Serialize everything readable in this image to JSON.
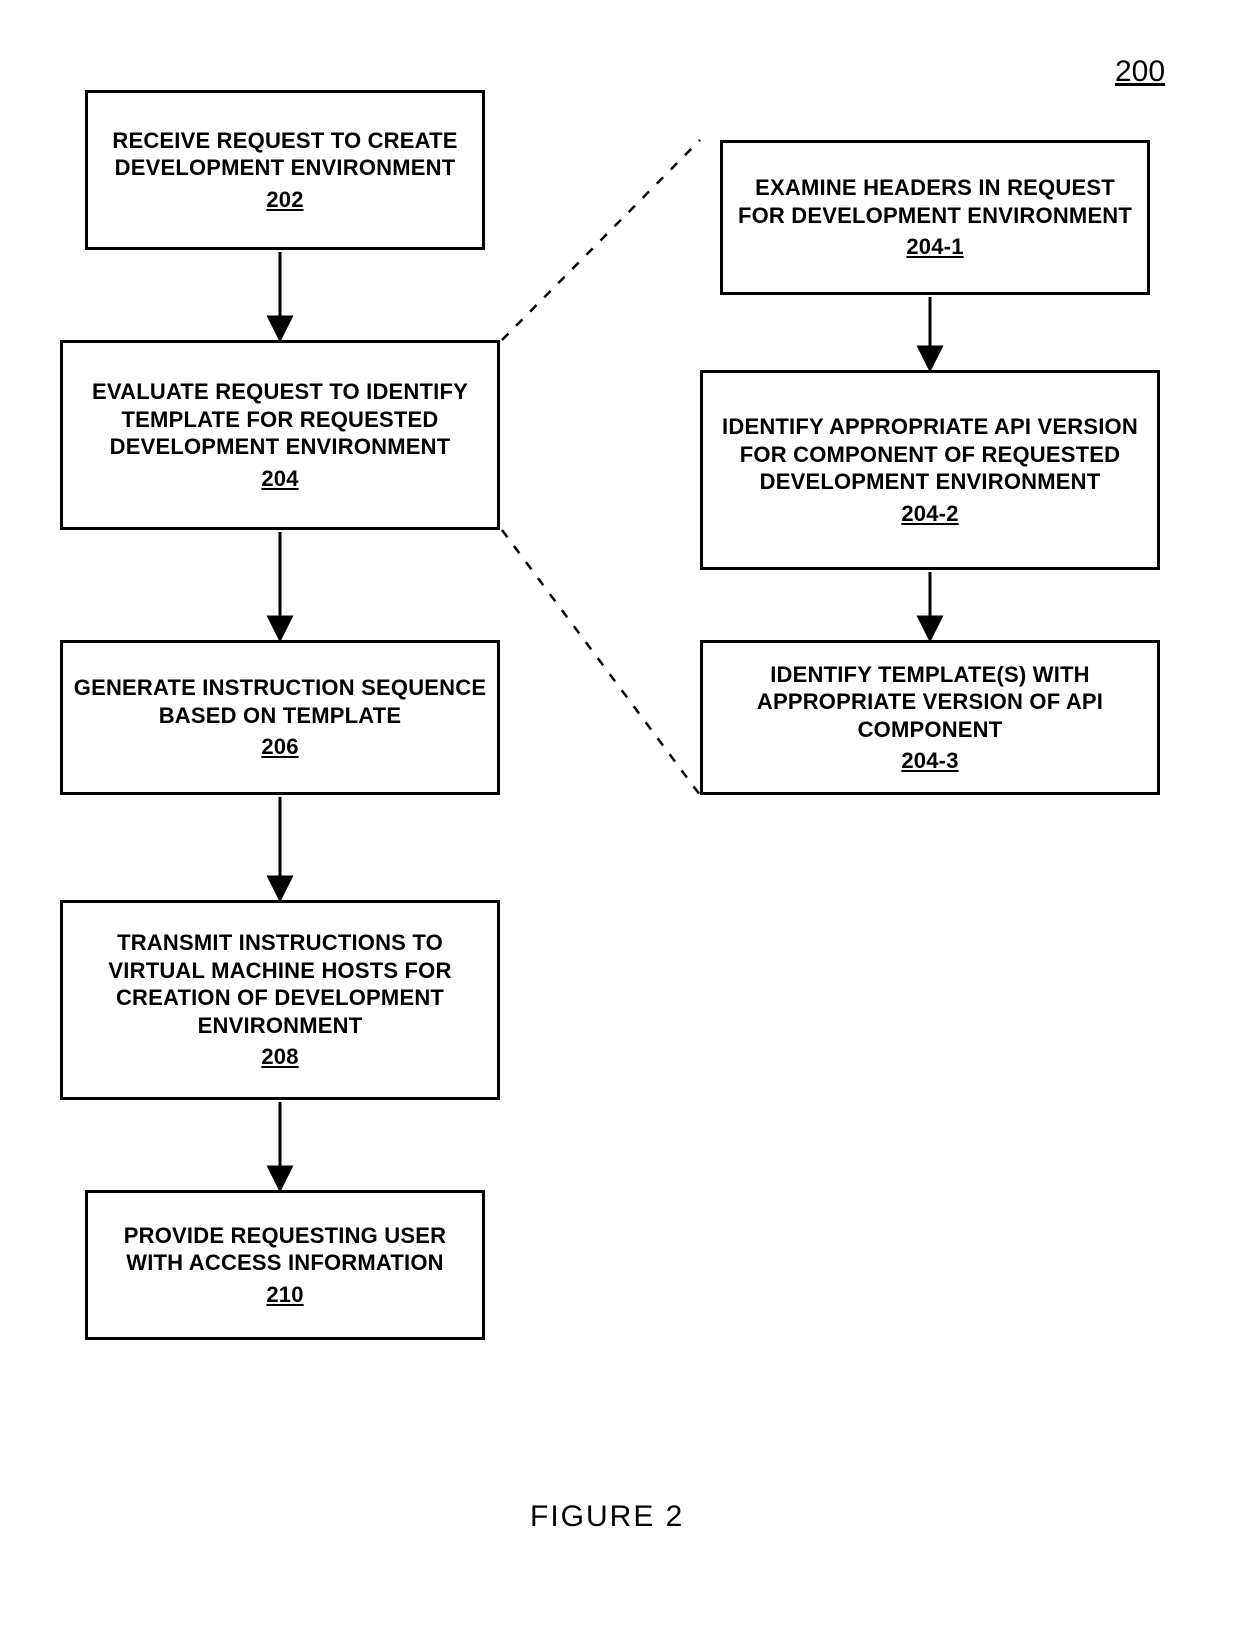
{
  "figure_ref": "200",
  "figure_label": "FIGURE 2",
  "left": {
    "b202": {
      "text": "RECEIVE REQUEST TO CREATE DEVELOPMENT ENVIRONMENT",
      "ref": "202"
    },
    "b204": {
      "text": "EVALUATE REQUEST TO IDENTIFY TEMPLATE FOR REQUESTED DEVELOPMENT ENVIRONMENT",
      "ref": "204"
    },
    "b206": {
      "text": "GENERATE INSTRUCTION SEQUENCE BASED ON TEMPLATE",
      "ref": "206"
    },
    "b208": {
      "text": "TRANSMIT INSTRUCTIONS TO VIRTUAL MACHINE HOSTS FOR CREATION OF DEVELOPMENT ENVIRONMENT",
      "ref": "208"
    },
    "b210": {
      "text": "PROVIDE REQUESTING USER WITH ACCESS INFORMATION",
      "ref": "210"
    }
  },
  "right": {
    "b204_1": {
      "text": "EXAMINE HEADERS IN REQUEST FOR DEVELOPMENT ENVIRONMENT",
      "ref": "204-1"
    },
    "b204_2": {
      "text": "IDENTIFY APPROPRIATE API VERSION FOR COMPONENT OF REQUESTED DEVELOPMENT ENVIRONMENT",
      "ref": "204-2"
    },
    "b204_3": {
      "text": "IDENTIFY TEMPLATE(S) WITH APPROPRIATE VERSION OF API COMPONENT",
      "ref": "204-3"
    }
  }
}
